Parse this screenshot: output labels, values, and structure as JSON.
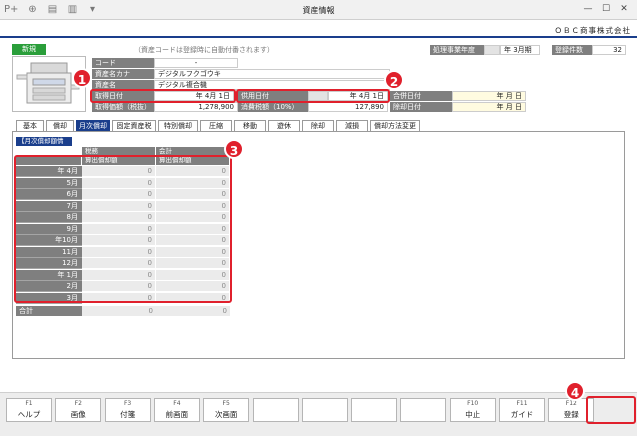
{
  "window": {
    "title": "資産情報",
    "company": "ＯＢＣ商事株式会社",
    "toolbar_icons": [
      "add-icon",
      "zoom-icon",
      "print-icon",
      "print-setup-icon",
      "dropdown-icon"
    ]
  },
  "header": {
    "new_badge": "新規",
    "note": "（資産コードは登録時に自動付番されます）",
    "fiscal_year_label": "処理事業年度",
    "fiscal_year_value": "年 3月期",
    "registered_count_label": "登録件数",
    "registered_count_value": "32"
  },
  "fields": {
    "code_label": "コード",
    "code_value": "-",
    "kana_label": "資産名カナ",
    "kana_value": "デジタルフクゴウキ",
    "name_label": "資産名",
    "name_value": "デジタル複合機",
    "acq_date_label": "取得日付",
    "acq_date_value": "年  4月  1日",
    "use_date_label": "供用日付",
    "use_date_value": "年  4月  1日",
    "merge_date_label": "合併日付",
    "merge_date_value": "年   月   日",
    "acq_price_label": "取得価額（税抜）",
    "acq_price_value": "1,278,900",
    "tax_label": "消費税額（10%）",
    "tax_value": "127,890",
    "retire_date_label": "除却日付",
    "retire_date_value": "年   月   日"
  },
  "tabs": [
    "基本",
    "償却",
    "月次償却",
    "固定資産税",
    "特別償却",
    "圧縮",
    "移動",
    "遊休",
    "除却",
    "減損",
    "償却方法変更"
  ],
  "active_tab": 2,
  "monthly": {
    "section_title": "【月次償却額情報】",
    "col_tax": "税務",
    "col_accounting": "会計",
    "sub_tax": "算出償却額",
    "sub_accounting": "算出償却額",
    "rows": [
      {
        "month": "年 4月",
        "tax": "0",
        "acc": "0"
      },
      {
        "month": "5月",
        "tax": "0",
        "acc": "0"
      },
      {
        "month": "6月",
        "tax": "0",
        "acc": "0"
      },
      {
        "month": "7月",
        "tax": "0",
        "acc": "0"
      },
      {
        "month": "8月",
        "tax": "0",
        "acc": "0"
      },
      {
        "month": "9月",
        "tax": "0",
        "acc": "0"
      },
      {
        "month": "年10月",
        "tax": "0",
        "acc": "0"
      },
      {
        "month": "11月",
        "tax": "0",
        "acc": "0"
      },
      {
        "month": "12月",
        "tax": "0",
        "acc": "0"
      },
      {
        "month": "年 1月",
        "tax": "0",
        "acc": "0"
      },
      {
        "month": "2月",
        "tax": "0",
        "acc": "0"
      },
      {
        "month": "3月",
        "tax": "0",
        "acc": "0"
      }
    ],
    "total_label": "合計",
    "total_tax": "0",
    "total_acc": "0"
  },
  "callouts": [
    "1",
    "2",
    "3",
    "4"
  ],
  "fkeys": [
    {
      "key": "F1",
      "label": "ヘルプ"
    },
    {
      "key": "F2",
      "label": "画像"
    },
    {
      "key": "F3",
      "label": "付箋"
    },
    {
      "key": "F4",
      "label": "前画面"
    },
    {
      "key": "F5",
      "label": "次画面"
    },
    {
      "key": "",
      "label": ""
    },
    {
      "key": "",
      "label": ""
    },
    {
      "key": "",
      "label": ""
    },
    {
      "key": "",
      "label": ""
    },
    {
      "key": "F10",
      "label": "中止"
    },
    {
      "key": "F11",
      "label": "ガイド"
    },
    {
      "key": "F12",
      "label": "登録"
    }
  ],
  "colors": {
    "accent": "#1a3e8c",
    "annotation": "#e0202c",
    "new_badge": "#2a9e3a"
  }
}
